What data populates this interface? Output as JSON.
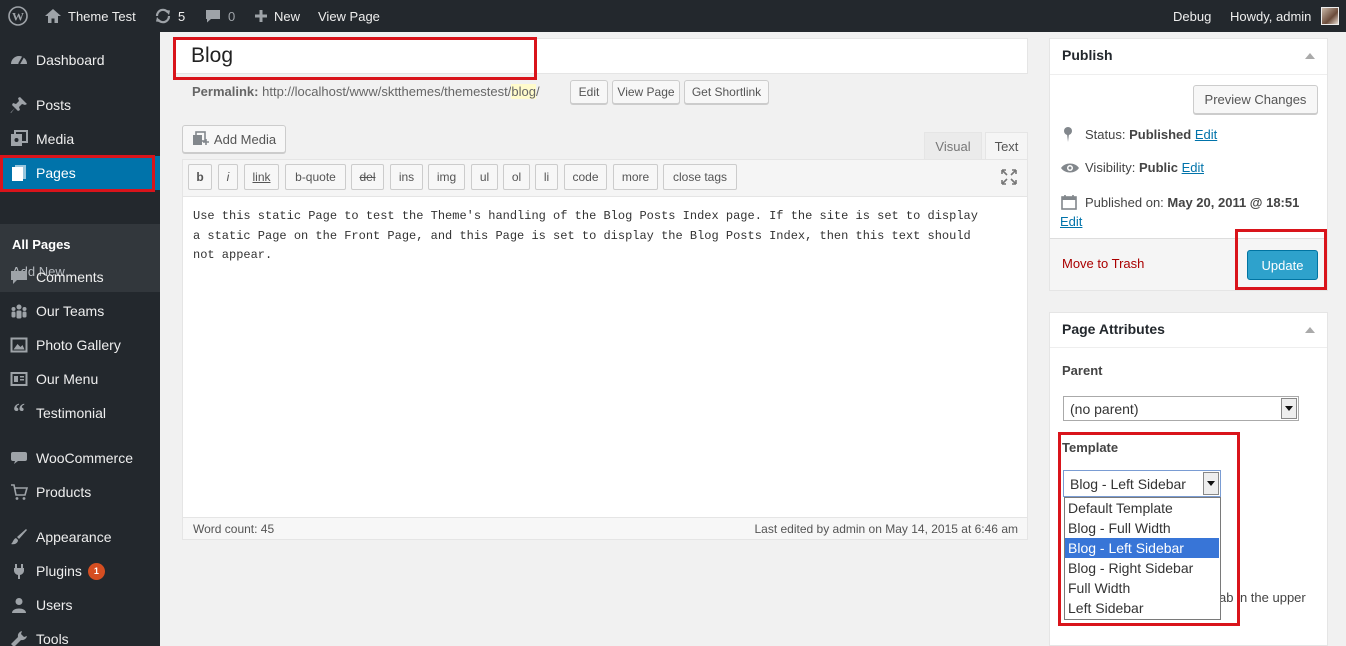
{
  "adminbar": {
    "site_name": "Theme Test",
    "updates_count": "5",
    "comments_count": "0",
    "new_label": "New",
    "view_page_label": "View Page",
    "debug_label": "Debug",
    "howdy_label": "Howdy, admin"
  },
  "sidebar": {
    "items": [
      {
        "label": "Dashboard",
        "icon": "dashboard-icon"
      },
      {
        "label": "Posts",
        "icon": "pin-icon"
      },
      {
        "label": "Media",
        "icon": "media-icon"
      },
      {
        "label": "Pages",
        "icon": "pages-icon"
      },
      {
        "label": "Comments",
        "icon": "comment-icon"
      },
      {
        "label": "Our Teams",
        "icon": "groups-icon"
      },
      {
        "label": "Photo Gallery",
        "icon": "image-icon"
      },
      {
        "label": "Our Menu",
        "icon": "menu-icon"
      },
      {
        "label": "Testimonial",
        "icon": "quote-icon"
      },
      {
        "label": "WooCommerce",
        "icon": "woo-icon"
      },
      {
        "label": "Products",
        "icon": "cart-icon"
      },
      {
        "label": "Appearance",
        "icon": "brush-icon"
      },
      {
        "label": "Plugins",
        "icon": "plug-icon",
        "badge": "1"
      },
      {
        "label": "Users",
        "icon": "user-icon"
      },
      {
        "label": "Tools",
        "icon": "wrench-icon"
      }
    ],
    "submenu": {
      "all_pages": "All Pages",
      "add_new": "Add New"
    }
  },
  "editor": {
    "title_value": "Blog",
    "permalink_label": "Permalink:",
    "permalink_base": "http://localhost/www/sktthemes/themestest/",
    "permalink_slug": "blog",
    "permalink_tail": "/",
    "edit_btn": "Edit",
    "view_page_btn": "View Page",
    "shortlink_btn": "Get Shortlink",
    "add_media": "Add Media",
    "tab_visual": "Visual",
    "tab_text": "Text",
    "quicktags": [
      "b",
      "i",
      "link",
      "b-quote",
      "del",
      "ins",
      "img",
      "ul",
      "ol",
      "li",
      "code",
      "more",
      "close tags"
    ],
    "content": "Use this static Page to test the Theme's handling of the Blog Posts Index page. If the site is set to display a static Page on the Front Page, and this Page is set to display the Blog Posts Index, then this text should not appear.",
    "word_count": "Word count: 45",
    "last_edited": "Last edited by admin on May 14, 2015 at 6:46 am"
  },
  "publish": {
    "title": "Publish",
    "preview_btn": "Preview Changes",
    "status_label": "Status:",
    "status_value": "Published",
    "visibility_label": "Visibility:",
    "visibility_value": "Public",
    "published_on_label": "Published on:",
    "published_on_value": "May 20, 2011 @ 18:51",
    "edit_link": "Edit",
    "trash": "Move to Trash",
    "update_btn": "Update"
  },
  "attributes": {
    "title": "Page Attributes",
    "parent_label": "Parent",
    "parent_value": "(no parent)",
    "template_label": "Template",
    "template_value": "Blog - Left Sidebar",
    "template_options": [
      "Default Template",
      "Blog - Full Width",
      "Blog - Left Sidebar",
      "Blog - Right Sidebar",
      "Full Width",
      "Left Sidebar"
    ],
    "selected_index": 2,
    "help_partial": "ab in the upper"
  },
  "colors": {
    "accent": "#0073aa",
    "highlight_box": "#d9141b",
    "update_button": "#2ea2cc",
    "option_selected": "#3875d7"
  }
}
